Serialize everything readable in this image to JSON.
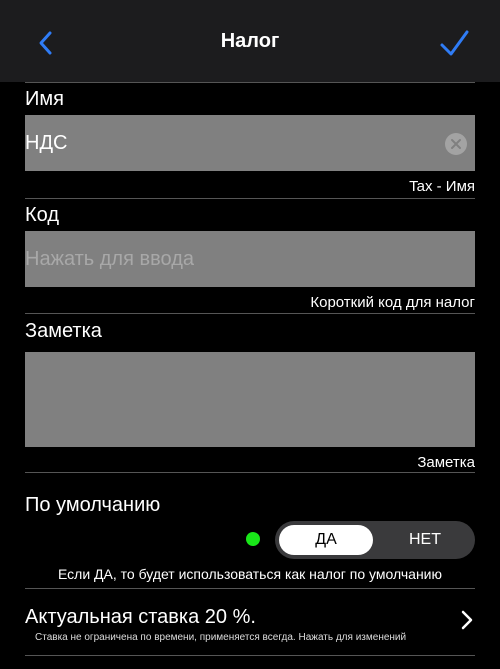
{
  "nav": {
    "title": "Налог",
    "back_icon": "chevron-left-icon",
    "done_icon": "checkmark-icon",
    "accent_color": "#2f7cf6"
  },
  "name": {
    "label": "Имя",
    "value": "НДС",
    "hint": "Tax - Имя"
  },
  "code": {
    "label": "Код",
    "placeholder": "Нажать для ввода",
    "hint": "Короткий код для налог"
  },
  "note": {
    "label": "Заметка",
    "hint": "Заметка"
  },
  "default": {
    "label": "По умолчанию",
    "options": [
      "ДА",
      "НЕТ"
    ],
    "selected": "ДА",
    "status_color": "#19e619",
    "hint": "Если ДА, то будет использоваться как налог по умолчанию"
  },
  "rate": {
    "title": "Актуальная ставка 20 %.",
    "subtitle": "Ставка не ограничена по времени, применяется всегда. Нажать для изменений",
    "chevron_icon": "chevron-right-icon"
  }
}
